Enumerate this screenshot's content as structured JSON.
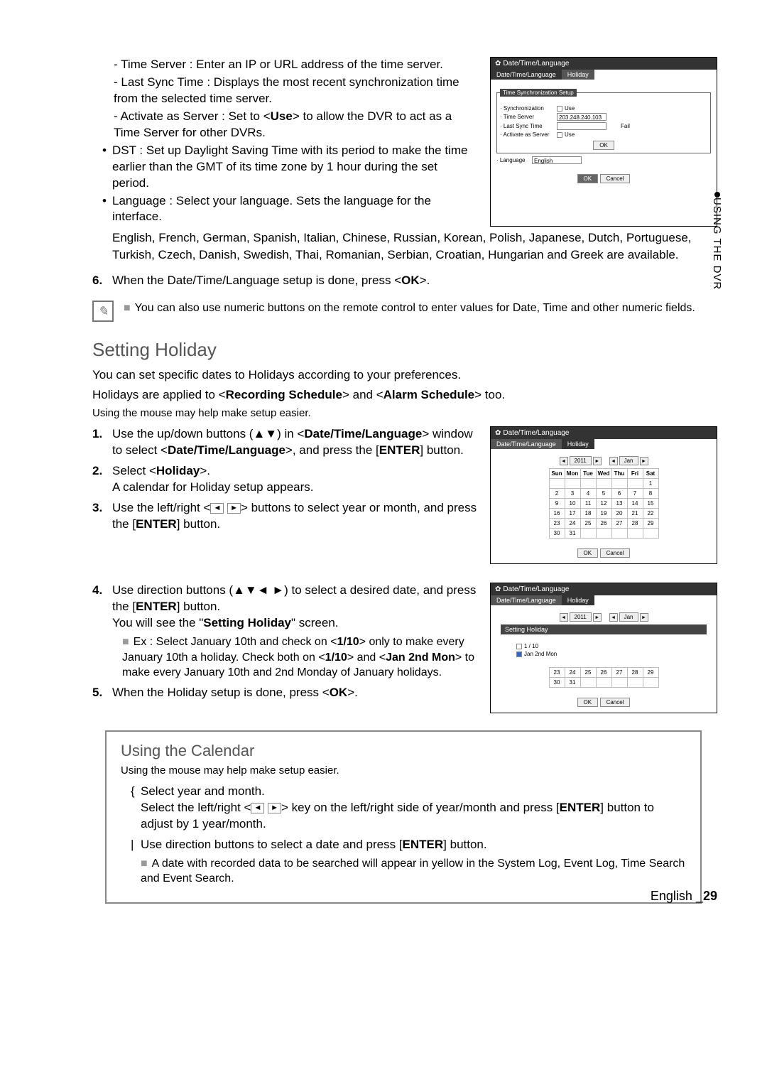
{
  "sidebar": {
    "label": "USING THE DVR"
  },
  "intro": {
    "timeServer": "Time Server : Enter an IP or URL address of the time server.",
    "lastSync": "Last Sync Time : Displays the most recent synchronization time from the selected time server.",
    "activateServer_a": "Activate as Server : Set to <",
    "activateServer_use": "Use",
    "activateServer_b": "> to allow the DVR to act as a Time Server for other DVRs.",
    "dst": "DST : Set up Daylight Saving Time with its period to make the time earlier than the GMT of its time zone by 1 hour during the set period.",
    "language": "Language : Select your language. Sets the language for the interface.",
    "langList": "English, French, German, Spanish, Italian, Chinese, Russian, Korean, Polish, Japanese, Dutch, Portuguese, Turkish, Czech, Danish, Swedish, Thai, Romanian, Serbian, Croatian, Hungarian and Greek are available.",
    "step6_a": "When the Date/Time/Language setup is done, press <",
    "step6_ok": "OK",
    "step6_b": ">.",
    "note": "You can also use numeric buttons on the remote control to enter values for Date, Time and other numeric fields."
  },
  "shot1": {
    "title": "Date/Time/Language",
    "tab1": "Date/Time/Language",
    "tab2": "Holiday",
    "panelTitle": "Time Synchronization Setup",
    "sync": "Synchronization",
    "use": "Use",
    "tserver": "Time Server",
    "ip": "203.248.240.103",
    "lastSync": "Last Sync Time",
    "fail": "Fail",
    "activate": "Activate as Server",
    "okBtn": "OK",
    "lang": "Language",
    "langVal": "English",
    "cancel": "Cancel"
  },
  "holiday": {
    "heading": "Setting Holiday",
    "p1": "You can set specific dates to Holidays according to your preferences.",
    "p2a": "Holidays are applied to <",
    "p2b": "Recording Schedule",
    "p2c": "> and <",
    "p2d": "Alarm Schedule",
    "p2e": "> too.",
    "mouse": "Using the mouse may help make setup easier.",
    "s1a": "Use the up/down buttons (▲▼) in <",
    "s1b": "Date/Time/Language",
    "s1c": "> window to select <",
    "s1d": "Date/Time/Language",
    "s1e": ">, and press the [",
    "s1f": "ENTER",
    "s1g": "] button.",
    "s2a": "Select <",
    "s2b": "Holiday",
    "s2c": ">.",
    "s2d": "A calendar for Holiday setup appears.",
    "s3a": "Use the left/right <",
    "s3b": "> buttons to select year or month, and press the [",
    "s3c": "ENTER",
    "s3d": "] button.",
    "s4a": "Use direction buttons (▲▼◄ ►) to select a desired date, and press the [",
    "s4b": "ENTER",
    "s4c": "] button.",
    "s4d": "You will see the \"",
    "s4e": "Setting Holiday",
    "s4f": "\" screen.",
    "ex_a": "Ex : Select January 10th and check on <",
    "ex_b": "1/10",
    "ex_c": "> only to make every January 10th a holiday. Check both on <",
    "ex_d": "1/10",
    "ex_e": "> and <",
    "ex_f": "Jan 2nd Mon",
    "ex_g": "> to make every January 10th and 2nd Monday of January holidays.",
    "s5a": "When the Holiday setup is done, press <",
    "s5b": "OK",
    "s5c": ">."
  },
  "shot2": {
    "title": "Date/Time/Language",
    "tab1": "Date/Time/Language",
    "tab2": "Holiday",
    "year": "2011",
    "month": "Jan",
    "dows": [
      "Sun",
      "Mon",
      "Tue",
      "Wed",
      "Thu",
      "Fri",
      "Sat"
    ],
    "ok": "OK",
    "cancel": "Cancel"
  },
  "shot3": {
    "title": "Date/Time/Language",
    "tab1": "Date/Time/Language",
    "tab2": "Holiday",
    "year": "2011",
    "month": "Jan",
    "panel": "Setting Holiday",
    "opt1": "1 / 10",
    "opt2": "Jan 2nd Mon",
    "ok": "OK",
    "cancel": "Cancel"
  },
  "calendar_box": {
    "heading": "Using the Calendar",
    "mouse": "Using the mouse may help make setup easier.",
    "i1a": "Select year and month.",
    "i1b_a": "Select the left/right <",
    "i1b_b": "> key on the left/right side of year/month and press [",
    "i1b_c": "ENTER",
    "i1b_d": "] button to adjust by 1 year/month.",
    "i2a": "Use direction buttons to select a date and press [",
    "i2b": "ENTER",
    "i2c": "] button.",
    "i3": "A date with recorded data to be searched will appear in yellow in the System Log, Event Log, Time Search and Event Search."
  },
  "footer": {
    "lang": "English",
    "page": "29"
  },
  "chart_data": {
    "type": "table",
    "title": "January 2011 calendar",
    "columns": [
      "Sun",
      "Mon",
      "Tue",
      "Wed",
      "Thu",
      "Fri",
      "Sat"
    ],
    "rows": [
      [
        "",
        "",
        "",
        "",
        "",
        "",
        "1"
      ],
      [
        "2",
        "3",
        "4",
        "5",
        "6",
        "7",
        "8"
      ],
      [
        "9",
        "10",
        "11",
        "12",
        "13",
        "14",
        "15"
      ],
      [
        "16",
        "17",
        "18",
        "19",
        "20",
        "21",
        "22"
      ],
      [
        "23",
        "24",
        "25",
        "26",
        "27",
        "28",
        "29"
      ],
      [
        "30",
        "31",
        "",
        "",
        "",
        "",
        ""
      ]
    ],
    "partial_rows": [
      [
        "23",
        "24",
        "25",
        "26",
        "27",
        "28",
        "29"
      ],
      [
        "30",
        "31",
        "",
        "",
        "",
        "",
        ""
      ]
    ]
  }
}
